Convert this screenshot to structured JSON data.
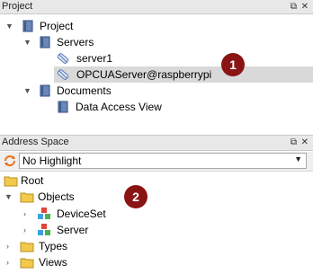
{
  "project_panel": {
    "title": "Project",
    "tree": {
      "root": "Project",
      "servers": "Servers",
      "server1": "server1",
      "opcua_server": "OPCUAServer@raspberrypi",
      "documents": "Documents",
      "data_access_view": "Data Access View"
    },
    "callout": "1"
  },
  "address_panel": {
    "title": "Address Space",
    "highlight_select": {
      "value": "No Highlight"
    },
    "tree": {
      "root": "Root",
      "objects": "Objects",
      "device_set": "DeviceSet",
      "server": "Server",
      "types": "Types",
      "views": "Views"
    },
    "callout": "2"
  },
  "header_buttons": {
    "float": "⧉",
    "close": "✕"
  },
  "colors": {
    "callout": "#8a1414",
    "folder": "#f2c94c",
    "selected_row": "#d9d9d9",
    "header_bg": "#e8e8e8"
  }
}
